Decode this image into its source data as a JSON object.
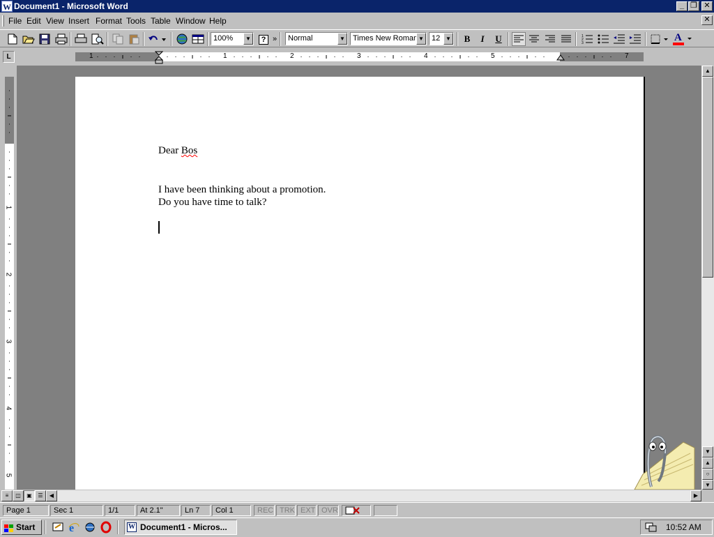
{
  "window": {
    "title": "Document1 - Microsoft Word",
    "app_icon": "W",
    "min_glyph": "_",
    "max_glyph": "❐",
    "close_glyph": "✕",
    "doc_close_glyph": "✕"
  },
  "menu": {
    "file": "File",
    "edit": "Edit",
    "view": "View",
    "insert": "Insert",
    "format": "Format",
    "tools": "Tools",
    "table": "Table",
    "window": "Window",
    "help": "Help"
  },
  "toolbar": {
    "zoom": "100%",
    "style": "Normal",
    "font": "Times New Roman",
    "size": "12",
    "bold": "B",
    "italic": "I",
    "underline": "U",
    "help_glyph": "?",
    "font_color_glyph": "A",
    "more_glyph": "»"
  },
  "ruler": {
    "tab_selector": "L",
    "h_numbers": [
      "1",
      "1",
      "2",
      "3",
      "4",
      "5",
      "7"
    ],
    "v_numbers": [
      "1",
      "2",
      "3",
      "4",
      "5"
    ]
  },
  "document": {
    "line1_pre": "Dear ",
    "line1_misspelled": "Bos",
    "line2": "I have been thinking about a promotion.",
    "line3": "Do you have time to talk?"
  },
  "statusbar": {
    "page": "Page 1",
    "sec": "Sec 1",
    "pages": "1/1",
    "at": "At 2.1\"",
    "ln": "Ln 7",
    "col": "Col 1",
    "rec": "REC",
    "trk": "TRK",
    "ext": "EXT",
    "ovr": "OVR"
  },
  "taskbar": {
    "start": "Start",
    "task": "Document1 - Micros...",
    "clock": "10:52 AM"
  },
  "icons": {
    "new": "new-document-icon",
    "open": "open-folder-icon",
    "save": "save-disk-icon",
    "clippy": "office-assistant-clippy-icon"
  },
  "colors": {
    "titlebar": "#0a246a",
    "face": "#c0c0c0",
    "spell_error": "#ff0000",
    "font_color": "#ff0000"
  }
}
